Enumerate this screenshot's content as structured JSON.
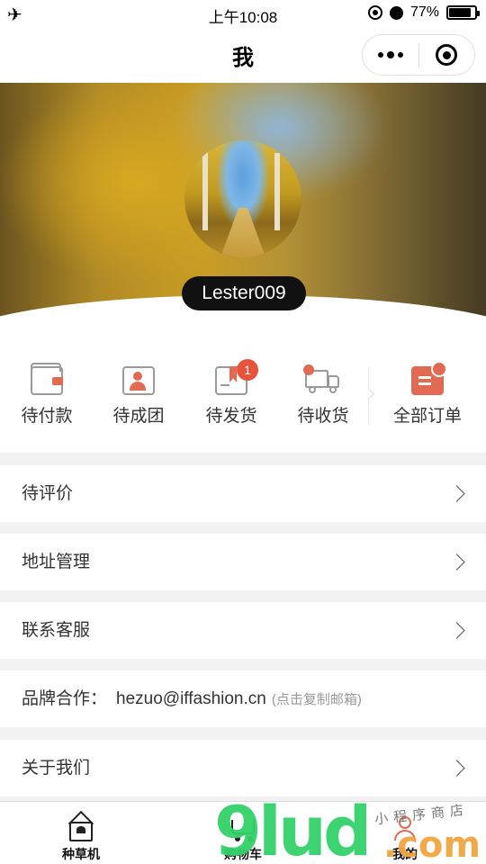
{
  "status_bar": {
    "time": "上午10:08",
    "battery": "77%"
  },
  "nav": {
    "title": "我"
  },
  "profile": {
    "username": "Lester009"
  },
  "orders": [
    {
      "label": "待付款",
      "icon": "wallet-icon"
    },
    {
      "label": "待成团",
      "icon": "group-icon"
    },
    {
      "label": "待发货",
      "icon": "ship-icon",
      "badge": "1"
    },
    {
      "label": "待收货",
      "icon": "truck-icon"
    },
    {
      "label": "全部订单",
      "icon": "all-orders-icon"
    }
  ],
  "menu": {
    "review": "待评价",
    "address": "地址管理",
    "service": "联系客服",
    "brand": {
      "label": "品牌合作：",
      "email": "hezuo@iffashion.cn",
      "hint": "(点击复制邮箱)"
    },
    "about": "关于我们"
  },
  "tabs": [
    {
      "label": "种草机"
    },
    {
      "label": "购物车"
    },
    {
      "label": "我的"
    }
  ],
  "watermark": {
    "big": "9lud",
    "com": ".com",
    "small": "小程序商店"
  },
  "colors": {
    "accent": "#e36a52",
    "badge": "#e8533b",
    "background": "#f2f2f2"
  }
}
